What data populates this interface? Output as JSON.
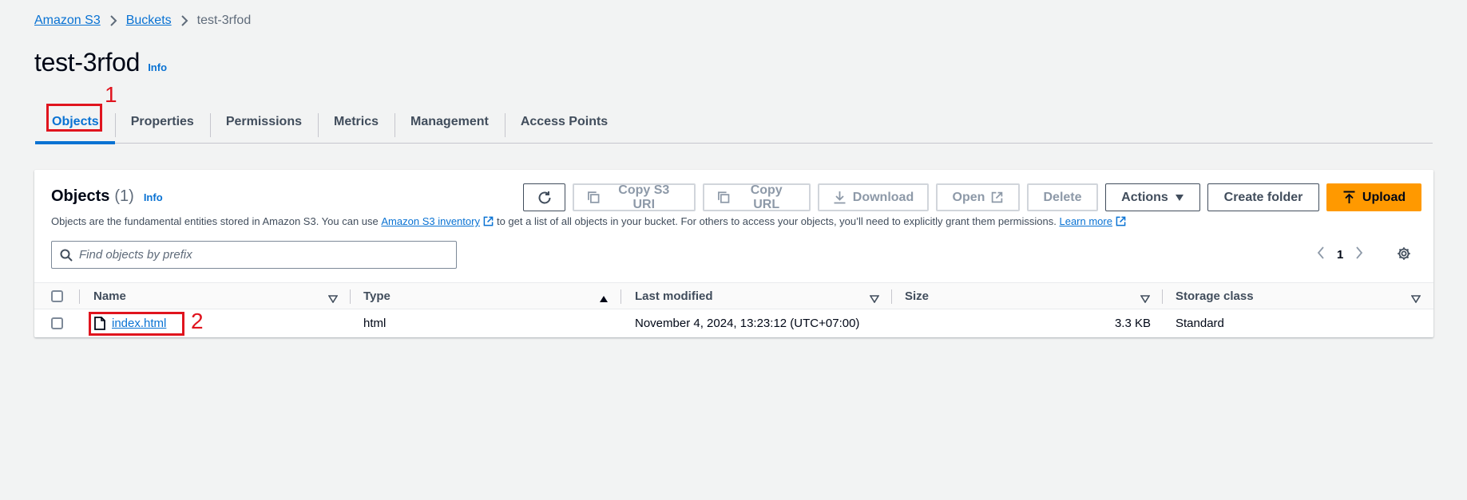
{
  "breadcrumb": {
    "items": [
      "Amazon S3",
      "Buckets"
    ],
    "current": "test-3rfod"
  },
  "page": {
    "title": "test-3rfod",
    "info": "Info"
  },
  "annotations": {
    "first": "1",
    "second": "2"
  },
  "tabs": [
    {
      "label": "Objects",
      "active": true
    },
    {
      "label": "Properties"
    },
    {
      "label": "Permissions"
    },
    {
      "label": "Metrics"
    },
    {
      "label": "Management"
    },
    {
      "label": "Access Points"
    }
  ],
  "panel": {
    "title": "Objects",
    "count": "(1)",
    "info": "Info",
    "desc_part1": "Objects are the fundamental entities stored in Amazon S3. You can use",
    "desc_link1": "Amazon S3 inventory",
    "desc_part2": "to get a list of all objects in your bucket. For others to access your objects, you’ll need to explicitly grant them permissions.",
    "desc_link2": "Learn more"
  },
  "toolbar": {
    "copy_s3_uri": "Copy S3 URI",
    "copy_url": "Copy URL",
    "download": "Download",
    "open": "Open",
    "delete": "Delete",
    "actions": "Actions",
    "create_folder": "Create folder",
    "upload": "Upload",
    "primary_color": "#ff9900"
  },
  "search": {
    "placeholder": "Find objects by prefix"
  },
  "pagination": {
    "current_page": "1"
  },
  "table": {
    "columns": [
      "Name",
      "Type",
      "Last modified",
      "Size",
      "Storage class"
    ],
    "rows": [
      {
        "name": "index.html",
        "type": "html",
        "last_modified": "November 4, 2024, 13:23:12 (UTC+07:00)",
        "size": "3.3 KB",
        "storage_class": "Standard"
      }
    ]
  }
}
